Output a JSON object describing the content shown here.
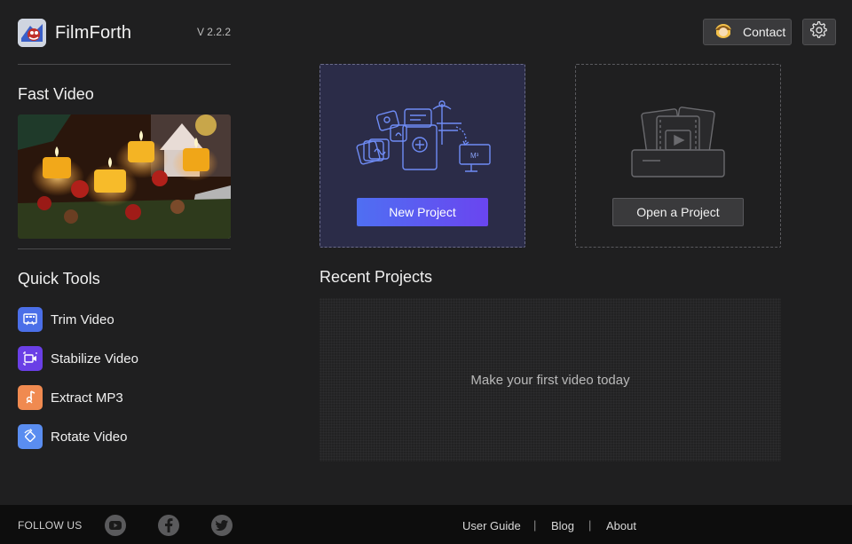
{
  "app": {
    "name": "FilmForth",
    "version": "V  2.2.2",
    "logo_icon": "filmforth-logo-icon"
  },
  "sidebar": {
    "fast_video_title": "Fast Video",
    "quick_tools_title": "Quick Tools",
    "tools": [
      {
        "label": "Trim Video",
        "icon": "trim-video-icon",
        "color": "#4b6fe8"
      },
      {
        "label": "Stabilize Video",
        "icon": "stabilize-video-icon",
        "color": "#6a3fe6"
      },
      {
        "label": "Extract MP3",
        "icon": "extract-mp3-icon",
        "color": "#f08a50"
      },
      {
        "label": "Rotate Video",
        "icon": "rotate-video-icon",
        "color": "#5a8df0"
      }
    ]
  },
  "header": {
    "contact_label": "Contact",
    "contact_icon": "support-avatar-icon",
    "settings_icon": "gear-icon"
  },
  "projects": {
    "new_label": "New Project",
    "open_label": "Open a Project"
  },
  "recent": {
    "title": "Recent Projects",
    "empty_text": "Make your first video today"
  },
  "footer": {
    "follow_label": "FOLLOW US",
    "social": [
      "youtube-icon",
      "facebook-icon",
      "twitter-icon"
    ],
    "links": [
      {
        "label": "User Guide"
      },
      {
        "label": "Blog"
      },
      {
        "label": "About"
      }
    ],
    "separator": "|"
  },
  "colors": {
    "background": "#1f1f20",
    "accent_start": "#4f6ff2",
    "accent_end": "#6a45f0",
    "new_card_bg": "#2b2c48",
    "footer_bg": "#0d0d0d"
  }
}
